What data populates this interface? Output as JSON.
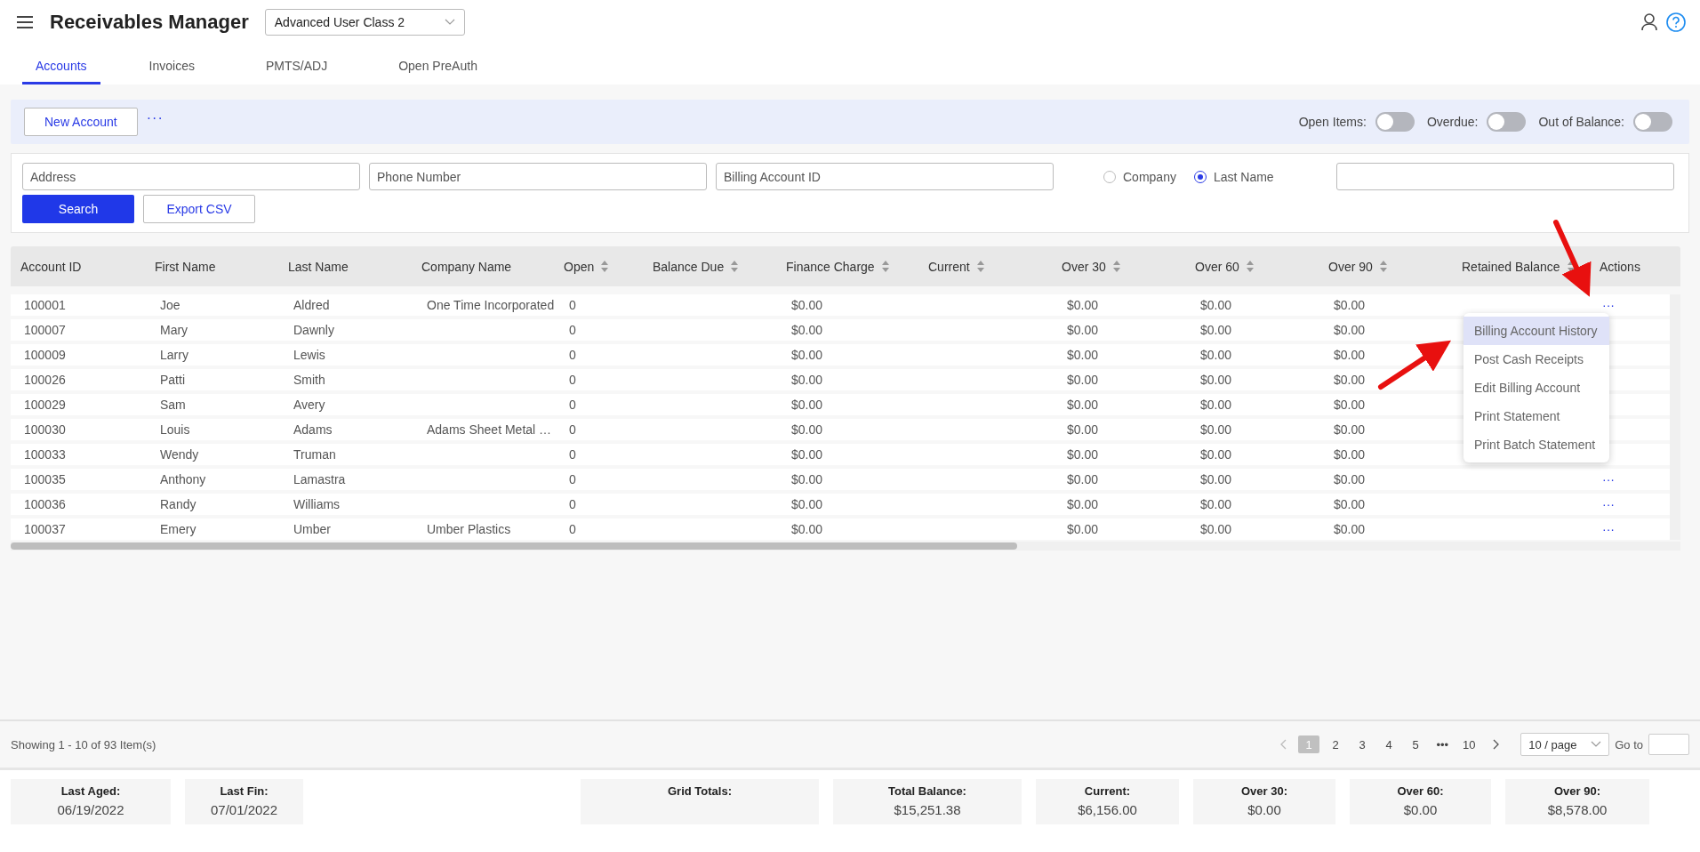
{
  "app": {
    "title": "Receivables Manager",
    "role_select": "Advanced User Class 2"
  },
  "tabs": [
    {
      "label": "Accounts",
      "selected": true
    },
    {
      "label": "Invoices",
      "selected": false
    },
    {
      "label": "PMTS/ADJ",
      "selected": false
    },
    {
      "label": "Open PreAuth",
      "selected": false
    }
  ],
  "toolbar": {
    "new_button": "New Account",
    "more": "···",
    "toggles": [
      {
        "label": "Open Items:",
        "on": false
      },
      {
        "label": "Overdue:",
        "on": false
      },
      {
        "label": "Out of Balance:",
        "on": false
      }
    ]
  },
  "search": {
    "fields": [
      {
        "placeholder": "Address"
      },
      {
        "placeholder": "Phone Number"
      },
      {
        "placeholder": "Billing Account ID"
      }
    ],
    "radios": [
      {
        "label": "Company",
        "selected": false
      },
      {
        "label": "Last Name",
        "selected": true
      }
    ],
    "search_button": "Search",
    "export_button": "Export CSV"
  },
  "table": {
    "columns": [
      {
        "label": "Account ID",
        "sortable": false
      },
      {
        "label": "First Name",
        "sortable": false
      },
      {
        "label": "Last Name",
        "sortable": false
      },
      {
        "label": "Company Name",
        "sortable": false
      },
      {
        "label": "Open",
        "sortable": true
      },
      {
        "label": "Balance Due",
        "sortable": true
      },
      {
        "label": "Finance Charge",
        "sortable": true
      },
      {
        "label": "Current",
        "sortable": true
      },
      {
        "label": "Over 30",
        "sortable": true
      },
      {
        "label": "Over 60",
        "sortable": true
      },
      {
        "label": "Over 90",
        "sortable": true
      },
      {
        "label": "Retained Balance",
        "sortable": true
      },
      {
        "label": "Actions",
        "sortable": false
      }
    ],
    "rows": [
      {
        "cells": [
          "100001",
          "Joe",
          "Aldred",
          "One Time Incorporated",
          "0",
          null,
          "$0.00",
          null,
          "$0.00",
          "$0.00",
          "$0.00",
          null
        ],
        "actions": "···"
      },
      {
        "cells": [
          "100007",
          "Mary",
          "Dawnly",
          null,
          "0",
          null,
          "$0.00",
          null,
          "$0.00",
          "$0.00",
          "$0.00",
          null
        ]
      },
      {
        "cells": [
          "100009",
          "Larry",
          "Lewis",
          null,
          "0",
          null,
          "$0.00",
          null,
          "$0.00",
          "$0.00",
          "$0.00",
          null
        ]
      },
      {
        "cells": [
          "100026",
          "Patti",
          "Smith",
          null,
          "0",
          null,
          "$0.00",
          null,
          "$0.00",
          "$0.00",
          "$0.00",
          null
        ]
      },
      {
        "cells": [
          "100029",
          "Sam",
          "Avery",
          null,
          "0",
          null,
          "$0.00",
          null,
          "$0.00",
          "$0.00",
          "$0.00",
          null
        ]
      },
      {
        "cells": [
          "100030",
          "Louis",
          "Adams",
          "Adams Sheet Metal …",
          "0",
          null,
          "$0.00",
          null,
          "$0.00",
          "$0.00",
          "$0.00",
          null
        ]
      },
      {
        "cells": [
          "100033",
          "Wendy",
          "Truman",
          null,
          "0",
          null,
          "$0.00",
          null,
          "$0.00",
          "$0.00",
          "$0.00",
          null
        ]
      },
      {
        "cells": [
          "100035",
          "Anthony",
          "Lamastra",
          null,
          "0",
          null,
          "$0.00",
          null,
          "$0.00",
          "$0.00",
          "$0.00",
          null
        ],
        "actions": "···"
      },
      {
        "cells": [
          "100036",
          "Randy",
          "Williams",
          null,
          "0",
          null,
          "$0.00",
          null,
          "$0.00",
          "$0.00",
          "$0.00",
          null
        ],
        "actions": "···"
      },
      {
        "cells": [
          "100037",
          "Emery",
          "Umber",
          "Umber Plastics",
          "0",
          null,
          "$0.00",
          null,
          "$0.00",
          "$0.00",
          "$0.00",
          null
        ],
        "actions": "···"
      }
    ]
  },
  "action_menu": [
    {
      "label": "Billing Account History",
      "selected": true
    },
    {
      "label": "Post Cash Receipts",
      "selected": false
    },
    {
      "label": "Edit Billing Account",
      "selected": false
    },
    {
      "label": "Print Statement",
      "selected": false
    },
    {
      "label": "Print Batch Statement",
      "selected": false
    }
  ],
  "pagination": {
    "summary": "Showing 1 - 10 of 93 Item(s)",
    "pages": [
      {
        "label": "1",
        "selected": true
      },
      {
        "label": "2",
        "selected": false
      },
      {
        "label": "3",
        "selected": false
      },
      {
        "label": "4",
        "selected": false
      },
      {
        "label": "5",
        "selected": false
      },
      {
        "label": "•••",
        "selected": false
      },
      {
        "label": "10",
        "selected": false
      }
    ],
    "page_size": "10 / page",
    "goto_label": "Go to"
  },
  "dates": [
    {
      "label": "Last Aged:",
      "value": "06/19/2022"
    },
    {
      "label": "Last Fin:",
      "value": "07/01/2022"
    }
  ],
  "totals": [
    {
      "label": "Grid Totals:"
    },
    {
      "label": "Total Balance:",
      "value": "$15,251.38"
    },
    {
      "label": "Current:",
      "value": "$6,156.00"
    },
    {
      "label": "Over 30:",
      "value": "$0.00"
    },
    {
      "label": "Over 60:",
      "value": "$0.00"
    },
    {
      "label": "Over 90:",
      "value": "$8,578.00"
    }
  ]
}
